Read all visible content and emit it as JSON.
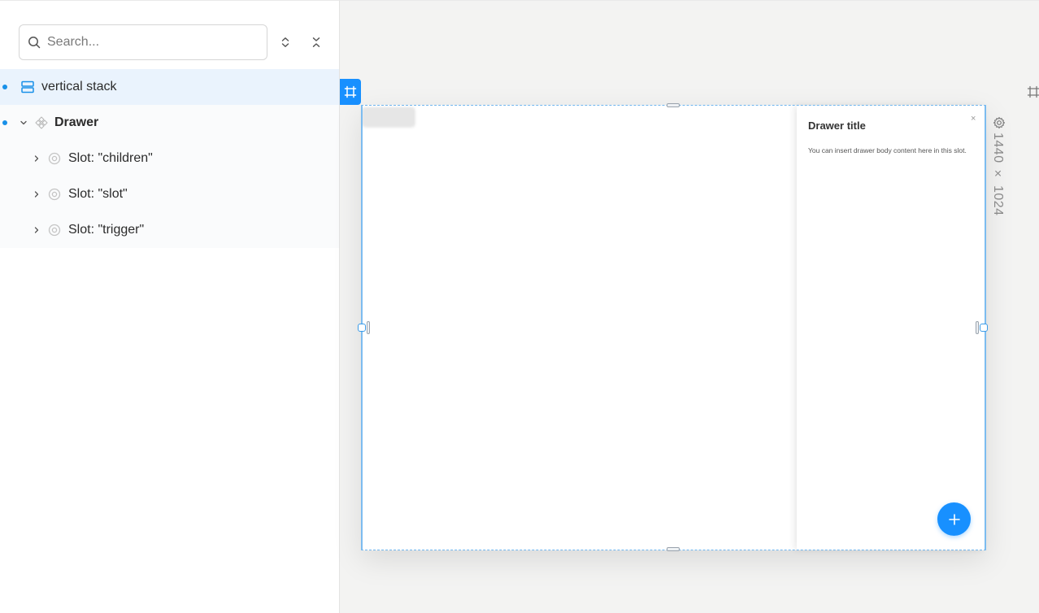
{
  "search": {
    "placeholder": "Search..."
  },
  "tree": {
    "items": [
      {
        "label": "vertical stack"
      },
      {
        "label": "Drawer"
      },
      {
        "label": "Slot: \"children\""
      },
      {
        "label": "Slot: \"slot\""
      },
      {
        "label": "Slot: \"trigger\""
      }
    ]
  },
  "drawer": {
    "title": "Drawer title",
    "close": "×",
    "body": "You can insert drawer body content here in this slot."
  },
  "frame": {
    "size": "1440 × 1024"
  },
  "colors": {
    "accent": "#1890ff",
    "selected_row": "#eaf3fd",
    "canvas_bg": "#f3f3f2"
  }
}
